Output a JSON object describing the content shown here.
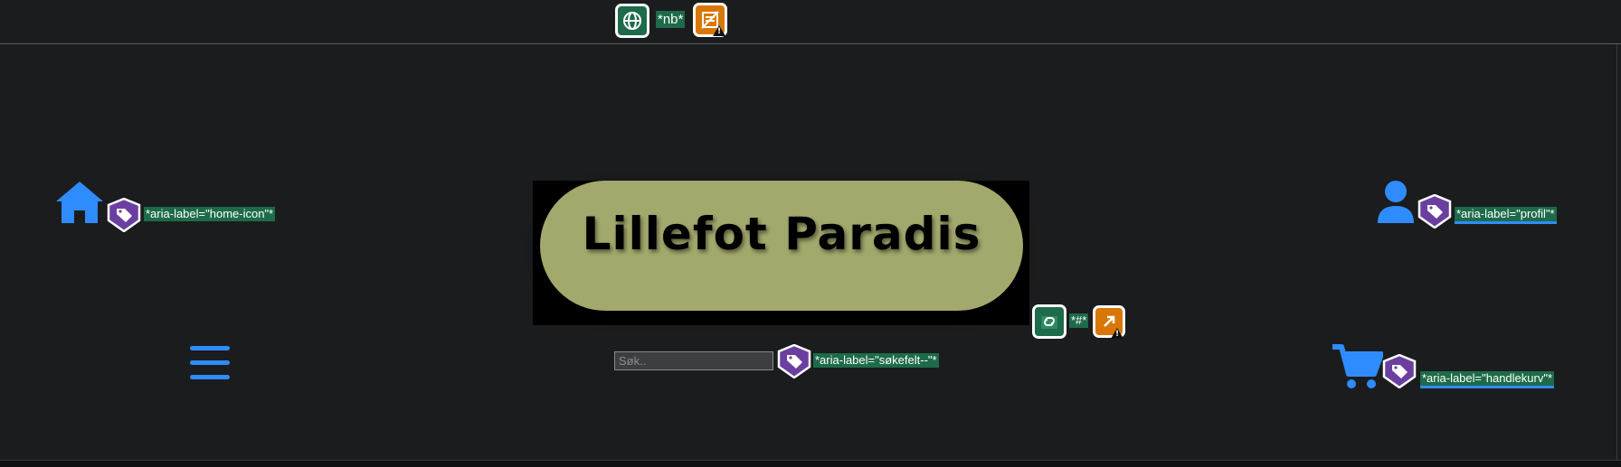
{
  "top_annotations": {
    "lang_label": "*nb*"
  },
  "header": {
    "home_aria": "*aria-label=\"home-icon\"*",
    "profile_aria": "*aria-label=\"profil\"*",
    "cart_aria": "*aria-label=\"handlekurv\"*",
    "search_aria": "*aria-label=\"søkefelt--\"*",
    "link_label": "*#*"
  },
  "logo": {
    "text": "Lillefot Paradis"
  },
  "search": {
    "placeholder": "Søk.."
  },
  "colors": {
    "accent": "#2f8cff",
    "background": "#1b1c1e",
    "logo_pill": "#a3a86c",
    "annotation_green": "#1d6b4a",
    "annotation_orange": "#d97706",
    "annotation_purple": "#6b3fa0"
  },
  "icons": [
    "home-icon",
    "user-icon",
    "cart-icon",
    "menu-icon",
    "globe-icon",
    "tag-icon",
    "link-icon",
    "document-icon",
    "external-link-icon"
  ]
}
